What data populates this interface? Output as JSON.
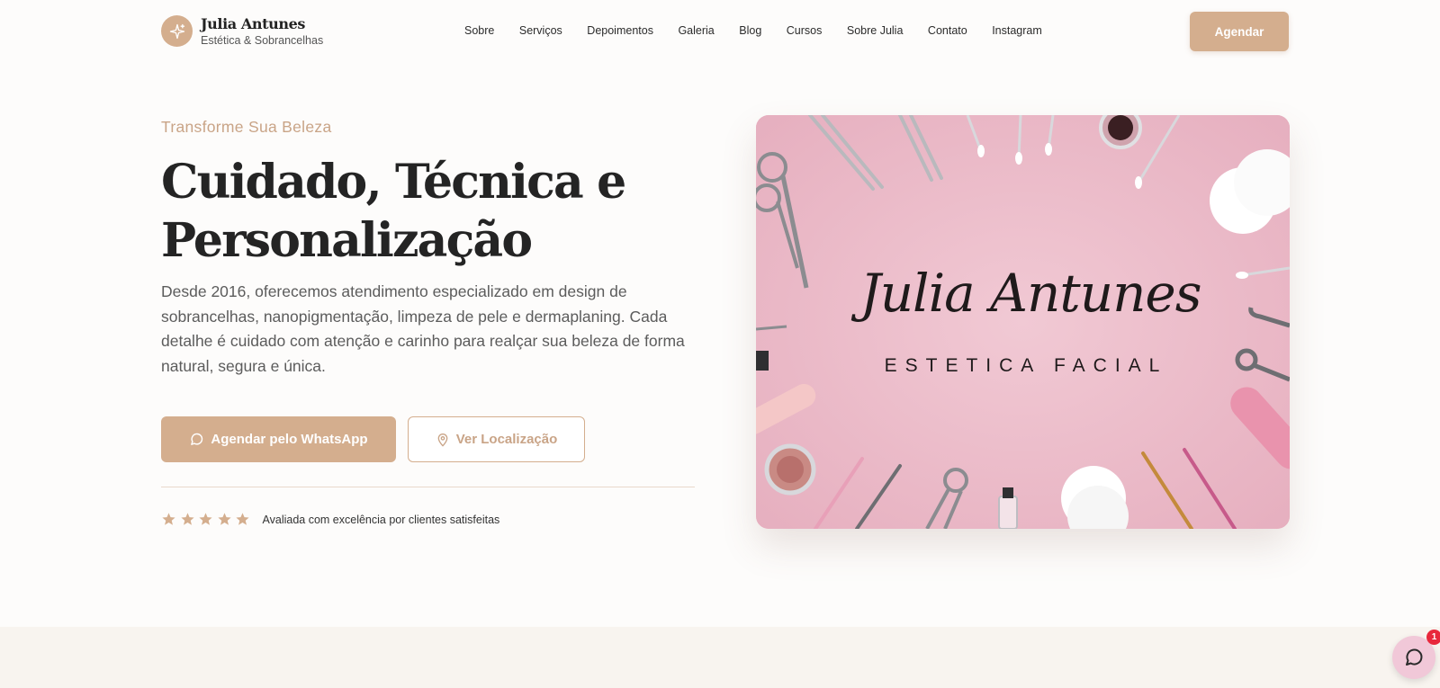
{
  "brand": {
    "name": "Julia Antunes",
    "subtitle": "Estética & Sobrancelhas",
    "logo_icon": "sparkle-icon"
  },
  "nav": {
    "items": [
      {
        "label": "Sobre"
      },
      {
        "label": "Serviços"
      },
      {
        "label": "Depoimentos"
      },
      {
        "label": "Galeria"
      },
      {
        "label": "Blog"
      },
      {
        "label": "Cursos"
      },
      {
        "label": "Sobre Julia"
      },
      {
        "label": "Contato"
      },
      {
        "label": "Instagram"
      }
    ],
    "cta_label": "Agendar"
  },
  "hero": {
    "eyebrow": "Transforme Sua Beleza",
    "headline": "Cuidado, Técnica e Personalização",
    "description": "Desde 2016, oferecemos atendimento especializado em design de sobrancelhas, nanopigmentação, limpeza de pele e dermaplaning. Cada detalhe é cuidado com atenção e carinho para realçar sua beleza de forma natural, segura e única.",
    "primary_button": {
      "label": "Agendar pelo WhatsApp",
      "icon": "chat-bubble-icon"
    },
    "secondary_button": {
      "label": "Ver Localização",
      "icon": "map-pin-icon"
    },
    "rating": {
      "stars": 5,
      "text": "Avaliada com excelência por clientes satisfeitas"
    },
    "image": {
      "script_title": "Julia Antunes",
      "caption": "ESTETICA FACIAL"
    }
  },
  "chat_widget": {
    "icon": "chat-bubble-icon",
    "badge_count": "1"
  },
  "colors": {
    "accent": "#d4ae8e",
    "accent_text": "#c9a487",
    "background": "#fdfcfb",
    "band": "#f8f4ef",
    "image_pink": "#ecbcc9",
    "badge_red": "#e8283c"
  }
}
